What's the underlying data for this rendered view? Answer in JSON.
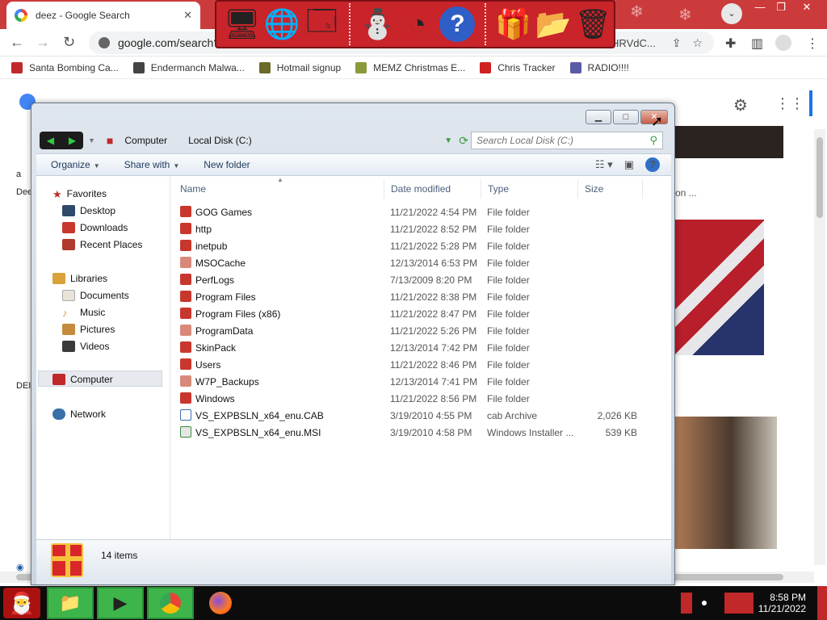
{
  "browser": {
    "tab_title": "deez - Google Search",
    "url": "google.com/search?",
    "url_tail": "HRVdC...",
    "bookmarks": [
      {
        "label": "Santa Bombing Ca...",
        "color": "#c0282a"
      },
      {
        "label": "Endermanch Malwa...",
        "color": "#444444"
      },
      {
        "label": "Hotmail signup",
        "color": "#6b6b2a"
      },
      {
        "label": "MEMZ Christmas E...",
        "color": "#8a9a3a"
      },
      {
        "label": "Chris Tracker",
        "color": "#d02020"
      },
      {
        "label": "RADIO!!!!",
        "color": "#5a5aa8"
      }
    ],
    "page_left_text": [
      "a",
      "Dee",
      "DEI"
    ],
    "page_right_text": "on ..."
  },
  "explorer": {
    "breadcrumbs": [
      "Computer",
      "Local Disk (C:)"
    ],
    "search_placeholder": "Search Local Disk (C:)",
    "commands": [
      "Organize",
      "Share with",
      "New folder"
    ],
    "nav": {
      "favorites": {
        "label": "Favorites",
        "items": [
          "Desktop",
          "Downloads",
          "Recent Places"
        ]
      },
      "libraries": {
        "label": "Libraries",
        "items": [
          "Documents",
          "Music",
          "Pictures",
          "Videos"
        ]
      },
      "computer": "Computer",
      "network": "Network"
    },
    "columns": {
      "name": "Name",
      "date": "Date modified",
      "type": "Type",
      "size": "Size"
    },
    "files": [
      {
        "name": "GOG Games",
        "date": "11/21/2022 4:54 PM",
        "type": "File folder",
        "size": ""
      },
      {
        "name": "http",
        "date": "11/21/2022 8:52 PM",
        "type": "File folder",
        "size": ""
      },
      {
        "name": "inetpub",
        "date": "11/21/2022 5:28 PM",
        "type": "File folder",
        "size": ""
      },
      {
        "name": "MSOCache",
        "date": "12/13/2014 6:53 PM",
        "type": "File folder",
        "size": ""
      },
      {
        "name": "PerfLogs",
        "date": "7/13/2009 8:20 PM",
        "type": "File folder",
        "size": ""
      },
      {
        "name": "Program Files",
        "date": "11/21/2022 8:38 PM",
        "type": "File folder",
        "size": ""
      },
      {
        "name": "Program Files (x86)",
        "date": "11/21/2022 8:47 PM",
        "type": "File folder",
        "size": ""
      },
      {
        "name": "ProgramData",
        "date": "11/21/2022 5:26 PM",
        "type": "File folder",
        "size": ""
      },
      {
        "name": "SkinPack",
        "date": "12/13/2014 7:42 PM",
        "type": "File folder",
        "size": ""
      },
      {
        "name": "Users",
        "date": "11/21/2022 8:46 PM",
        "type": "File folder",
        "size": ""
      },
      {
        "name": "W7P_Backups",
        "date": "12/13/2014 7:41 PM",
        "type": "File folder",
        "size": ""
      },
      {
        "name": "Windows",
        "date": "11/21/2022 8:56 PM",
        "type": "File folder",
        "size": ""
      },
      {
        "name": "VS_EXPBSLN_x64_enu.CAB",
        "date": "3/19/2010 4:55 PM",
        "type": "cab Archive",
        "size": "2,026 KB"
      },
      {
        "name": "VS_EXPBSLN_x64_enu.MSI",
        "date": "3/19/2010 4:58 PM",
        "type": "Windows Installer ...",
        "size": "539 KB"
      }
    ],
    "item_count": "14 items"
  },
  "taskbar": {
    "time": "8:58 PM",
    "date": "11/21/2022"
  },
  "colors": {
    "folder": "#c8372d",
    "folder_light": "#d9897a",
    "accent_red": "#c0282a",
    "accent_green": "#3db54a"
  }
}
